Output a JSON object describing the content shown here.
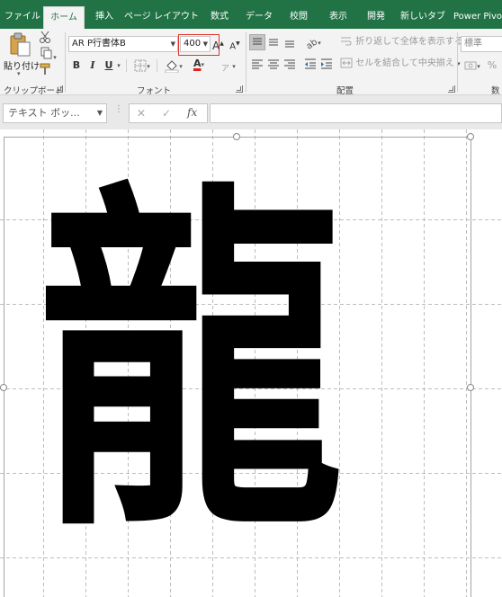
{
  "tabs": [
    {
      "label": "ファイル",
      "active": false
    },
    {
      "label": "ホーム",
      "active": true
    },
    {
      "label": "挿入",
      "active": false
    },
    {
      "label": "ページ レイアウト",
      "active": false
    },
    {
      "label": "数式",
      "active": false
    },
    {
      "label": "データ",
      "active": false
    },
    {
      "label": "校閲",
      "active": false
    },
    {
      "label": "表示",
      "active": false
    },
    {
      "label": "開発",
      "active": false
    },
    {
      "label": "新しいタブ",
      "active": false
    },
    {
      "label": "Power Pivot",
      "active": false
    }
  ],
  "clipboard": {
    "paste_label": "貼り付け",
    "group_label": "クリップボード"
  },
  "font": {
    "name_value": "AR P行書体B",
    "size_value": "400",
    "bold_label": "B",
    "italic_label": "I",
    "underline_label": "U",
    "grow_label": "A",
    "shrink_label": "A",
    "font_color_label": "A",
    "group_label": "フォント"
  },
  "alignment": {
    "wrap_label": "折り返して全体を表示する",
    "merge_label": "セルを結合して中央揃え",
    "group_label": "配置"
  },
  "number": {
    "format_value": "標準",
    "percent_label": "%",
    "group_label": "数"
  },
  "formula_bar": {
    "name_box_value": "テキスト ボッ...",
    "cancel_label": "✕",
    "enter_label": "✓",
    "fx_label": "fx",
    "formula_value": ""
  },
  "sheet": {
    "textbox_content": "龍"
  },
  "colors": {
    "ribbon_green": "#217346",
    "highlight_red": "#e0352b",
    "font_color_bar": "#e02020"
  }
}
